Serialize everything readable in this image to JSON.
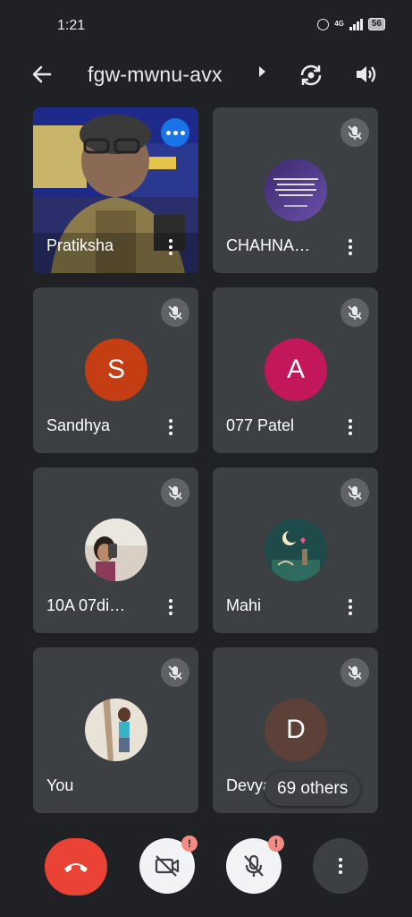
{
  "status_bar": {
    "time": "1:21",
    "network": "4G",
    "battery": "56"
  },
  "header": {
    "meeting_code": "fgw-mwnu-avx"
  },
  "tiles": [
    {
      "name": "Pratiksha",
      "type": "video"
    },
    {
      "name": "CHAHNA…",
      "type": "photo",
      "muted": true
    },
    {
      "name": "Sandhya",
      "type": "letter",
      "letter": "S",
      "color": "#c53d13",
      "muted": true
    },
    {
      "name": "077 Patel",
      "type": "letter",
      "letter": "A",
      "color": "#c2185b",
      "muted": true
    },
    {
      "name": "10A 07di…",
      "type": "photo",
      "muted": true
    },
    {
      "name": "Mahi",
      "type": "photo",
      "muted": true
    },
    {
      "name": "You",
      "type": "photo",
      "muted": true
    },
    {
      "name": "Devya",
      "type": "letter",
      "letter": "D",
      "color": "#5d4037",
      "muted": true
    }
  ],
  "others_chip": "69 others",
  "controls": {
    "end_call": "end-call",
    "camera": "camera-off",
    "mic": "mic-off",
    "more": "more"
  },
  "colors": {
    "background": "#202124",
    "tile": "#3c4043",
    "end_call": "#ea4335",
    "accent_blue": "#1a73e8",
    "warning": "#f28b82"
  }
}
